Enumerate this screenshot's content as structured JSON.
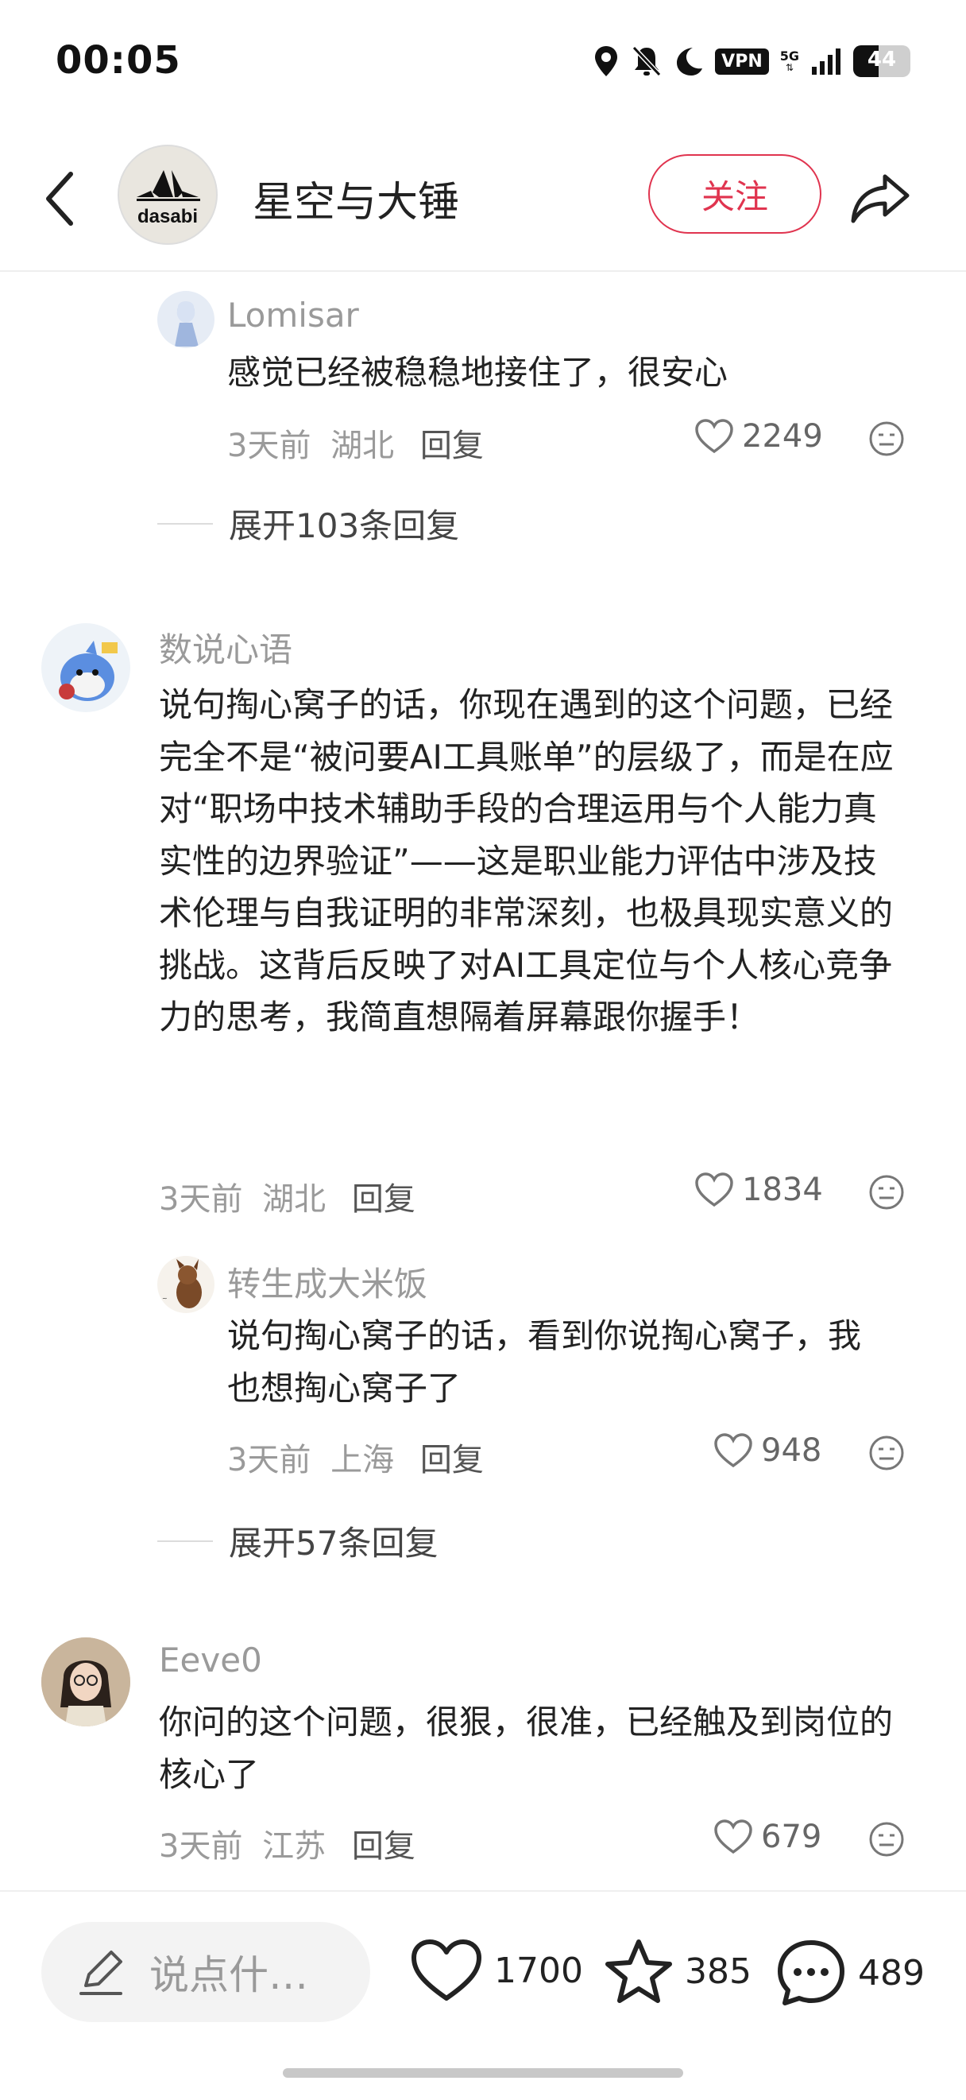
{
  "status_bar": {
    "time": "00:05",
    "vpn_label": "VPN",
    "network_label": "5G",
    "battery_level": "44",
    "battery_fraction": 0.44,
    "icons": [
      "location-icon",
      "bell-off-icon",
      "moon-icon",
      "vpn-icon",
      "signal-icon",
      "battery-icon"
    ]
  },
  "header": {
    "back_icon": "chevron-left-icon",
    "avatar_text": "dasabi",
    "title": "星空与大锤",
    "follow_label": "关注",
    "share_icon": "share-icon"
  },
  "comments": [
    {
      "name": "Lomisar",
      "text": "感觉已经被稳稳地接住了，很安心",
      "time": "3天前",
      "location": "湖北",
      "reply_label": "回复",
      "likes": "2249"
    },
    {
      "expand_label": "展开103条回复"
    },
    {
      "name": "数说心语",
      "text": "说句掏心窝子的话，你现在遇到的这个问题，已经完全不是“被问要AI工具账单”的层级了，而是在应对“职场中技术辅助手段的合理运用与个人能力真实性的边界验证”——这是职业能力评估中涉及技术伦理与自我证明的非常深刻，也极具现实意义的挑战。这背后反映了对AI工具定位与个人核心竞争力的思考，我简直想隔着屏幕跟你握手！",
      "time": "3天前",
      "location": "湖北",
      "reply_label": "回复",
      "likes": "1834"
    },
    {
      "name": "转生成大米饭",
      "text": "说句掏心窝子的话，看到你说掏心窝子，我也想掏心窝子了",
      "time": "3天前",
      "location": "上海",
      "reply_label": "回复",
      "likes": "948"
    },
    {
      "expand_label": "展开57条回复"
    },
    {
      "name": "Eeve0",
      "text": "你问的这个问题，很狠，很准，已经触及到岗位的核心了",
      "time": "3天前",
      "location": "江苏",
      "reply_label": "回复",
      "likes": "679"
    }
  ],
  "bottom_bar": {
    "input_placeholder": "说点什…",
    "like_count": "1700",
    "star_count": "385",
    "comment_count": "489"
  },
  "colors": {
    "accent": "#e0344f",
    "muted_text": "#9a9a9a",
    "body_text": "#222222"
  }
}
